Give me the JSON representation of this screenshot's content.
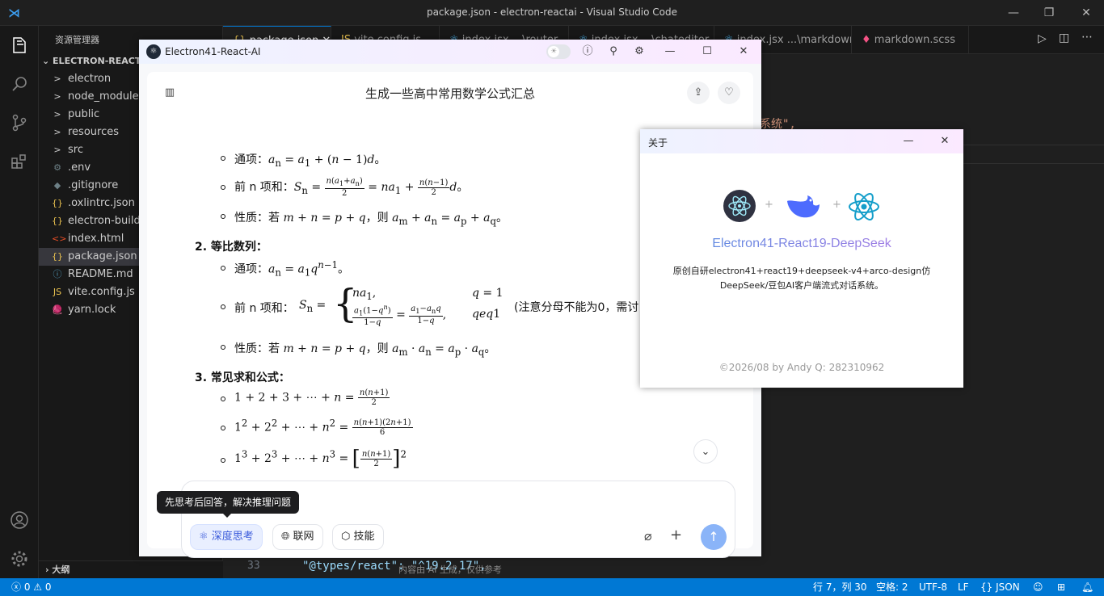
{
  "vscode": {
    "title": "package.json - electron-reactai - Visual Studio Code",
    "explorer_header": "资源管理器",
    "project": "ELECTRON-REACTAI",
    "tree": [
      {
        "label": "electron",
        "icon": ">"
      },
      {
        "label": "node_modules",
        "icon": ">"
      },
      {
        "label": "public",
        "icon": ">"
      },
      {
        "label": "resources",
        "icon": ">"
      },
      {
        "label": "src",
        "icon": ">"
      },
      {
        "label": ".env",
        "icon": "⚙"
      },
      {
        "label": ".gitignore",
        "icon": "◆"
      },
      {
        "label": ".oxlintrc.json",
        "icon": "{}"
      },
      {
        "label": "electron-builder",
        "icon": "{}"
      },
      {
        "label": "index.html",
        "icon": "<>"
      },
      {
        "label": "package.json",
        "icon": "{}"
      },
      {
        "label": "README.md",
        "icon": "ⓘ"
      },
      {
        "label": "vite.config.js",
        "icon": "JS"
      },
      {
        "label": "yarn.lock",
        "icon": "🧶"
      }
    ],
    "outline": "大纲",
    "tabs": [
      "package.json",
      "vite.config.js",
      "index.jsx ...\\router",
      "index.jsx ...\\chateditor",
      "index.jsx ...\\markdown",
      "markdown.scss"
    ],
    "code_fragment": "系统\",",
    "line_number": "33",
    "code_line": "\"@types/react\": \"^19.2.17\",",
    "status": {
      "errors": "0",
      "warnings": "0",
      "cursor": "行 7，列 30",
      "spaces": "空格: 2",
      "encoding": "UTF-8",
      "eol": "LF",
      "lang": "JSON"
    }
  },
  "chat": {
    "window_title": "Electron41-React-AI",
    "question": "生成一些高中常用数学公式汇总",
    "arith": {
      "tongxiang_label": "通项：",
      "sum_label": "前 n 项和：",
      "prop_label": "性质：若",
      "then": "，则"
    },
    "geo_heading": "2. 等比数列：",
    "geo_note": "(注意分母不能为0，需讨",
    "sum_heading": "3. 常见求和公式：",
    "tooltip": "先思考后回答，解决推理问题",
    "btn_deep": "深度思考",
    "btn_web": "联网",
    "btn_skill": "技能",
    "footnote": "内容由 AI 生成，仅供参考"
  },
  "about": {
    "title": "关于",
    "name": "Electron41-React19-DeepSeek",
    "desc": "原创自研electron41+react19+deepseek-v4+arco-design仿DeepSeek/豆包AI客户端流式对话系统。",
    "copyright": "©2026/08 by Andy   Q: 282310962"
  },
  "colors": {
    "accent": "#0078d4",
    "deepthink": "#3b5bdb",
    "send": "#8ab4f8"
  }
}
